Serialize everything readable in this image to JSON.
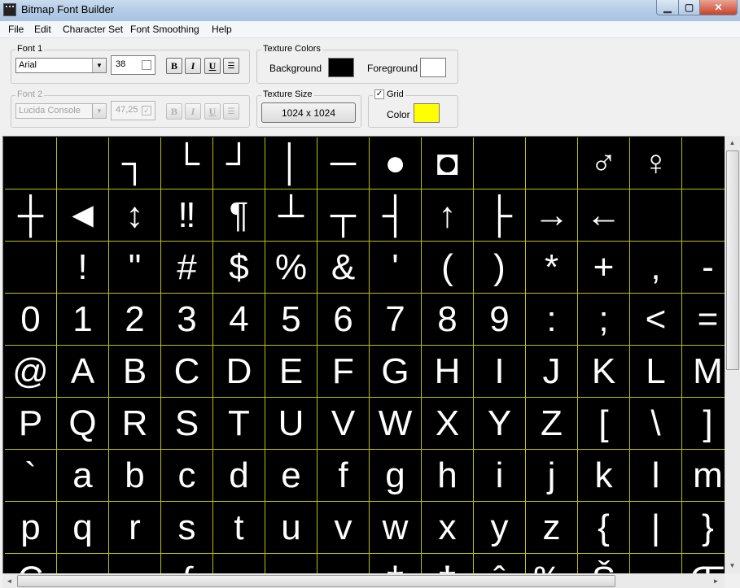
{
  "window": {
    "title": "Bitmap Font Builder"
  },
  "menu": [
    "File",
    "Edit",
    "Character Set",
    "Font Smoothing",
    "Help"
  ],
  "font1": {
    "legend": "Font 1",
    "name": "Arial",
    "size": "38",
    "bold": "B",
    "italic": "I",
    "underline": "U"
  },
  "font2": {
    "legend": "Font 2",
    "name": "Lucida Console",
    "size": "47,25",
    "bold": "B",
    "italic": "I",
    "underline": "U"
  },
  "texture_colors": {
    "legend": "Texture Colors",
    "background_label": "Background",
    "foreground_label": "Foreground",
    "background_color": "#000000",
    "foreground_color": "#ffffff"
  },
  "texture_size": {
    "legend": "Texture Size",
    "value": "1024 x 1024"
  },
  "grid": {
    "label": "Grid",
    "checked": true,
    "color_label": "Color",
    "color": "#ffff00"
  },
  "glyphs": [
    "",
    "",
    "┐",
    "└",
    "┘",
    "│",
    "─",
    "●",
    "◘",
    "",
    "",
    "♂",
    "♀",
    "",
    "┼",
    "◄",
    "↕",
    "‼",
    "¶",
    "┴",
    "┬",
    "┤",
    "↑",
    "├",
    "→",
    "←",
    "",
    "",
    "",
    "!",
    "\"",
    "#",
    "$",
    "%",
    "&",
    "'",
    "(",
    ")",
    "*",
    "+",
    ",",
    "-",
    "0",
    "1",
    "2",
    "3",
    "4",
    "5",
    "6",
    "7",
    "8",
    "9",
    ":",
    ";",
    "<",
    "=",
    "@",
    "A",
    "B",
    "C",
    "D",
    "E",
    "F",
    "G",
    "H",
    "I",
    "J",
    "K",
    "L",
    "M",
    "P",
    "Q",
    "R",
    "S",
    "T",
    "U",
    "V",
    "W",
    "X",
    "Y",
    "Z",
    "[",
    "\\",
    "]",
    "`",
    "a",
    "b",
    "c",
    "d",
    "e",
    "f",
    "g",
    "h",
    "i",
    "j",
    "k",
    "l",
    "m",
    "p",
    "q",
    "r",
    "s",
    "t",
    "u",
    "v",
    "w",
    "x",
    "y",
    "z",
    "{",
    "|",
    "}",
    "Ç",
    "",
    "",
    "ƒ",
    "",
    "",
    "",
    "‡",
    "†",
    "ˆ",
    "‰",
    "Š",
    "",
    "Œ"
  ]
}
